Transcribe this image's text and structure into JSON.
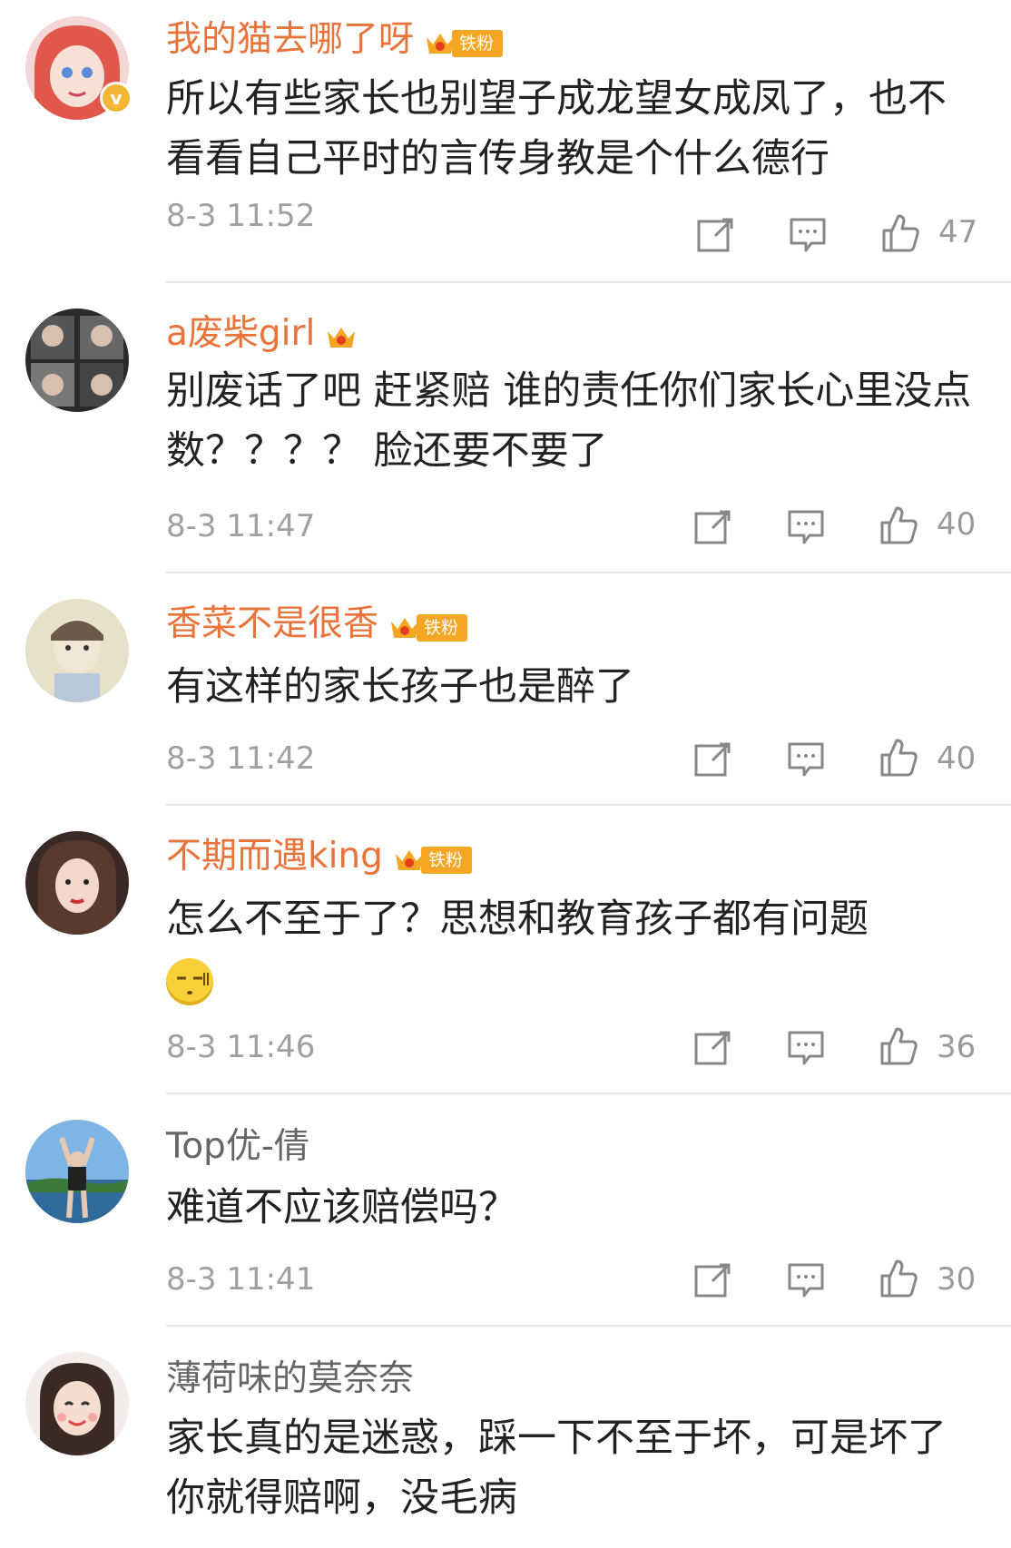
{
  "comments": [
    {
      "username": "我的猫去哪了呀",
      "fan_badge": "铁粉",
      "verified": true,
      "text": "所以有些家长也别望子成龙望女成凤了，也不看看自己平时的言传身教是个什么德行",
      "time": "8-3 11:52",
      "likes": "47"
    },
    {
      "username": "a废柴girl",
      "fan_badge": "",
      "text": "别废话了吧 赶紧赔 谁的责任你们家长心里没点数？？？？ 脸还要不要了",
      "time": "8-3 11:47",
      "likes": "40"
    },
    {
      "username": "香菜不是很香",
      "fan_badge": "铁粉",
      "text": "有这样的家长孩子也是醉了",
      "time": "8-3 11:42",
      "likes": "40"
    },
    {
      "username": "不期而遇king",
      "fan_badge": "铁粉",
      "text": "怎么不至于了？思想和教育孩子都有问题",
      "time": "8-3 11:46",
      "likes": "36"
    },
    {
      "username": "Top优-倩",
      "fan_badge": "",
      "text": "难道不应该赔偿吗？",
      "time": "8-3 11:41",
      "likes": "30"
    },
    {
      "username": "薄荷味的莫奈奈",
      "fan_badge": "",
      "text": "家长真的是迷惑，踩一下不至于坏，可是坏了你就得赔啊，没毛病"
    }
  ],
  "icons": {
    "verified": "v-badge-icon",
    "crown": "crown-icon",
    "repost": "repost-icon",
    "reply": "reply-icon",
    "like": "thumbs-up-icon"
  },
  "colors": {
    "member_name": "#e8743b",
    "regular_name": "#666666",
    "fan_badge": "#f5a623",
    "meta": "#a0a0a0"
  }
}
